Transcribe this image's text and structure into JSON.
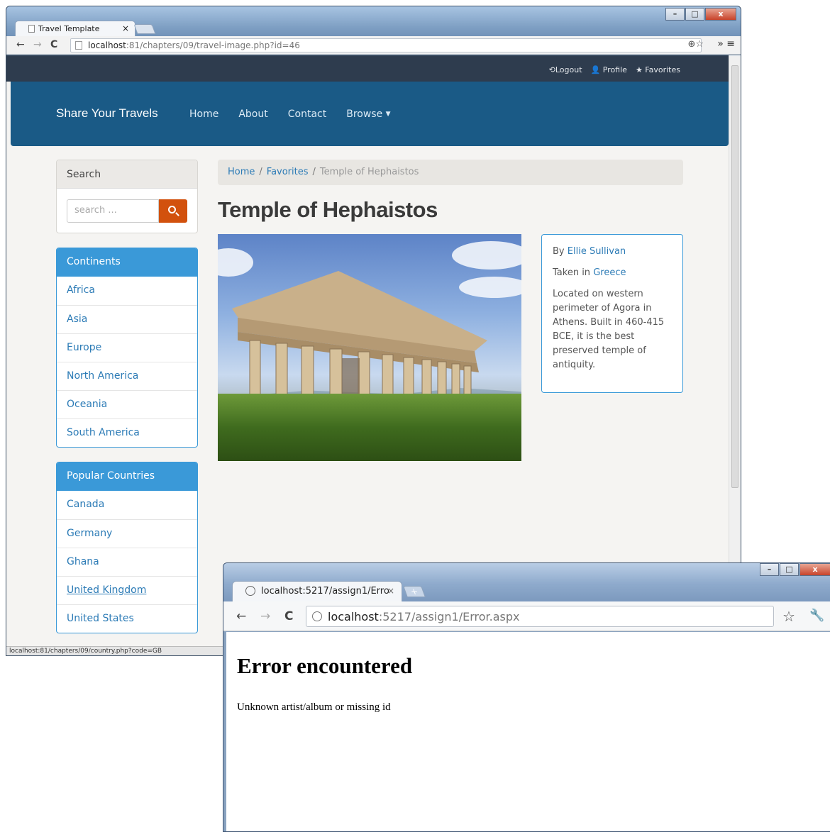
{
  "window1": {
    "tab_title": "Travel Template",
    "url_host": "localhost",
    "url_rest": ":81/chapters/09/travel-image.php?id=46",
    "topbar": {
      "logout": "Logout",
      "profile": "Profile",
      "favorites": "Favorites"
    },
    "navbar": {
      "brand": "Share Your Travels",
      "links": [
        "Home",
        "About",
        "Contact",
        "Browse"
      ]
    },
    "search": {
      "heading": "Search",
      "placeholder": "search ..."
    },
    "continents": {
      "heading": "Continents",
      "items": [
        "Africa",
        "Asia",
        "Europe",
        "North America",
        "Oceania",
        "South America"
      ]
    },
    "countries": {
      "heading": "Popular Countries",
      "items": [
        "Canada",
        "Germany",
        "Ghana",
        "United Kingdom",
        "United States"
      ]
    },
    "breadcrumb": {
      "home": "Home",
      "favorites": "Favorites",
      "current": "Temple of Hephaistos"
    },
    "title": "Temple of Hephaistos",
    "info": {
      "by_prefix": "By",
      "author": "Ellie Sullivan",
      "taken_prefix": "Taken in",
      "country": "Greece",
      "description": "Located on western perimeter of Agora in Athens. Built in 460-415 BCE, it is the best preserved temple of antiquity."
    },
    "status_url": "localhost:81/chapters/09/country.php?code=GB"
  },
  "window2": {
    "tab_title": "localhost:5217/assign1/Erro",
    "url_host": "localhost",
    "url_rest": ":5217/assign1/Error.aspx",
    "heading": "Error encountered",
    "message": "Unknown artist/album or missing id"
  },
  "colors": {
    "navbar": "#1a5a86",
    "topbar": "#2e3c4e",
    "accent": "#3a99d8",
    "search_button": "#d2510d",
    "link": "#2c7bb6"
  }
}
